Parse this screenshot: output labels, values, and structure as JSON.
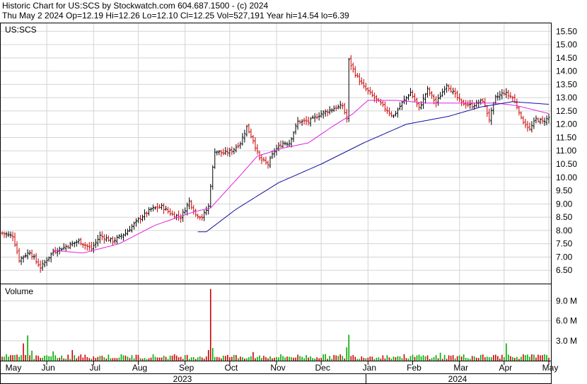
{
  "header": {
    "line1": "Historic Chart for US:SCS by Stockwatch.com 604.687.1500 - (c) 2024",
    "line2": "Thu May  2 2024  Op=12.19  Hi=12.26  Lo=12.10  Cl=12.25  Vol=527,191  Year hi=14.54  lo=6.39"
  },
  "colors": {
    "up": "#000000",
    "down": "#cc0000",
    "ma_short": "#e020e0",
    "ma_long": "#1010a0",
    "volume_up": "#00aa00",
    "volume_down": "#cc0000"
  },
  "chart_data": [
    {
      "type": "ohlc",
      "symbol_label": "US:SCS",
      "y_ticks": [
        6.5,
        7.0,
        7.5,
        8.0,
        8.5,
        9.0,
        9.5,
        10.0,
        10.5,
        11.0,
        11.5,
        12.0,
        12.5,
        13.0,
        13.5,
        14.0,
        14.5,
        15.0,
        15.5
      ],
      "y_tick_labels": [
        "6.50",
        "7.00",
        "7.50",
        "8.00",
        "8.50",
        "9.00",
        "9.50",
        "10.00",
        "10.50",
        "11.00",
        "11.50",
        "12.00",
        "12.50",
        "13.00",
        "13.50",
        "14.00",
        "14.50",
        "15.00",
        "15.50"
      ],
      "ylim": [
        6.0,
        15.8
      ],
      "grid": true,
      "x_month_labels": [
        "May",
        "Jun",
        "Jul",
        "Aug",
        "Sep",
        "Oct",
        "Nov",
        "Dec",
        "Jan",
        "Feb",
        "Mar",
        "Apr",
        "May"
      ],
      "x_year_labels": [
        "2023",
        "2024"
      ],
      "price_keypoints": [
        {
          "d": 0,
          "c": 7.9
        },
        {
          "d": 5,
          "c": 7.8
        },
        {
          "d": 8,
          "c": 6.9
        },
        {
          "d": 13,
          "c": 7.2
        },
        {
          "d": 18,
          "c": 6.6
        },
        {
          "d": 24,
          "c": 7.2
        },
        {
          "d": 30,
          "c": 7.4
        },
        {
          "d": 36,
          "c": 7.6
        },
        {
          "d": 42,
          "c": 7.3
        },
        {
          "d": 46,
          "c": 7.8
        },
        {
          "d": 52,
          "c": 7.6
        },
        {
          "d": 58,
          "c": 7.9
        },
        {
          "d": 64,
          "c": 8.4
        },
        {
          "d": 70,
          "c": 8.8
        },
        {
          "d": 75,
          "c": 8.9
        },
        {
          "d": 80,
          "c": 8.6
        },
        {
          "d": 84,
          "c": 8.5
        },
        {
          "d": 88,
          "c": 9.1
        },
        {
          "d": 91,
          "c": 8.6
        },
        {
          "d": 94,
          "c": 8.5
        },
        {
          "d": 97,
          "c": 8.9
        },
        {
          "d": 98,
          "c": 9.7
        },
        {
          "d": 100,
          "c": 11.0
        },
        {
          "d": 104,
          "c": 10.9
        },
        {
          "d": 108,
          "c": 11.0
        },
        {
          "d": 112,
          "c": 11.3
        },
        {
          "d": 115,
          "c": 11.9
        },
        {
          "d": 118,
          "c": 11.4
        },
        {
          "d": 121,
          "c": 10.7
        },
        {
          "d": 125,
          "c": 10.5
        },
        {
          "d": 128,
          "c": 11.0
        },
        {
          "d": 132,
          "c": 11.3
        },
        {
          "d": 135,
          "c": 11.3
        },
        {
          "d": 139,
          "c": 12.1
        },
        {
          "d": 144,
          "c": 12.1
        },
        {
          "d": 150,
          "c": 12.4
        },
        {
          "d": 156,
          "c": 12.6
        },
        {
          "d": 160,
          "c": 12.7
        },
        {
          "d": 162,
          "c": 12.2
        },
        {
          "d": 163,
          "c": 14.4
        },
        {
          "d": 166,
          "c": 13.9
        },
        {
          "d": 170,
          "c": 13.4
        },
        {
          "d": 175,
          "c": 13.0
        },
        {
          "d": 180,
          "c": 12.6
        },
        {
          "d": 184,
          "c": 12.3
        },
        {
          "d": 188,
          "c": 12.8
        },
        {
          "d": 192,
          "c": 13.2
        },
        {
          "d": 196,
          "c": 12.6
        },
        {
          "d": 200,
          "c": 13.3
        },
        {
          "d": 204,
          "c": 12.8
        },
        {
          "d": 209,
          "c": 13.5
        },
        {
          "d": 212,
          "c": 13.2
        },
        {
          "d": 216,
          "c": 12.8
        },
        {
          "d": 221,
          "c": 12.7
        },
        {
          "d": 226,
          "c": 12.9
        },
        {
          "d": 229,
          "c": 12.2
        },
        {
          "d": 232,
          "c": 13.0
        },
        {
          "d": 236,
          "c": 13.2
        },
        {
          "d": 240,
          "c": 13.0
        },
        {
          "d": 243,
          "c": 12.5
        },
        {
          "d": 244,
          "c": 12.2
        },
        {
          "d": 248,
          "c": 11.8
        },
        {
          "d": 251,
          "c": 12.2
        },
        {
          "d": 254,
          "c": 12.1
        },
        {
          "d": 257,
          "c": 12.25
        }
      ],
      "ma_short_keypoints": [
        {
          "d": 24,
          "c": 7.25
        },
        {
          "d": 38,
          "c": 7.15
        },
        {
          "d": 55,
          "c": 7.5
        },
        {
          "d": 72,
          "c": 8.2
        },
        {
          "d": 90,
          "c": 8.7
        },
        {
          "d": 98,
          "c": 8.85
        },
        {
          "d": 110,
          "c": 9.9
        },
        {
          "d": 120,
          "c": 10.8
        },
        {
          "d": 132,
          "c": 11.1
        },
        {
          "d": 144,
          "c": 11.3
        },
        {
          "d": 155,
          "c": 11.9
        },
        {
          "d": 165,
          "c": 12.4
        },
        {
          "d": 172,
          "c": 12.9
        },
        {
          "d": 185,
          "c": 12.9
        },
        {
          "d": 200,
          "c": 12.8
        },
        {
          "d": 215,
          "c": 12.8
        },
        {
          "d": 232,
          "c": 12.8
        },
        {
          "d": 242,
          "c": 12.7
        },
        {
          "d": 257,
          "c": 12.4
        }
      ],
      "ma_long_keypoints": [
        {
          "d": 92,
          "c": 7.95
        },
        {
          "d": 96,
          "c": 7.95
        },
        {
          "d": 110,
          "c": 8.8
        },
        {
          "d": 130,
          "c": 9.8
        },
        {
          "d": 150,
          "c": 10.5
        },
        {
          "d": 170,
          "c": 11.3
        },
        {
          "d": 190,
          "c": 12.0
        },
        {
          "d": 210,
          "c": 12.3
        },
        {
          "d": 225,
          "c": 12.65
        },
        {
          "d": 240,
          "c": 12.85
        },
        {
          "d": 257,
          "c": 12.75
        }
      ]
    },
    {
      "type": "bar",
      "label": "Volume",
      "y_ticks": [
        3.0,
        6.0,
        9.0
      ],
      "y_tick_labels": [
        "3.0 M",
        "6.0 M",
        "9.0 M"
      ],
      "ylim": [
        0,
        11.5
      ],
      "spikes": [
        {
          "d": 10,
          "v": 2.6
        },
        {
          "d": 12,
          "v": 3.8
        },
        {
          "d": 14,
          "v": 1.5
        },
        {
          "d": 24,
          "v": 1.4
        },
        {
          "d": 33,
          "v": 1.6
        },
        {
          "d": 98,
          "v": 10.8
        },
        {
          "d": 97,
          "v": 1.6
        },
        {
          "d": 99,
          "v": 1.9
        },
        {
          "d": 163,
          "v": 3.9
        },
        {
          "d": 162,
          "v": 2.0
        },
        {
          "d": 237,
          "v": 2.6
        },
        {
          "d": 118,
          "v": 1.3
        },
        {
          "d": 206,
          "v": 1.2
        }
      ]
    }
  ]
}
